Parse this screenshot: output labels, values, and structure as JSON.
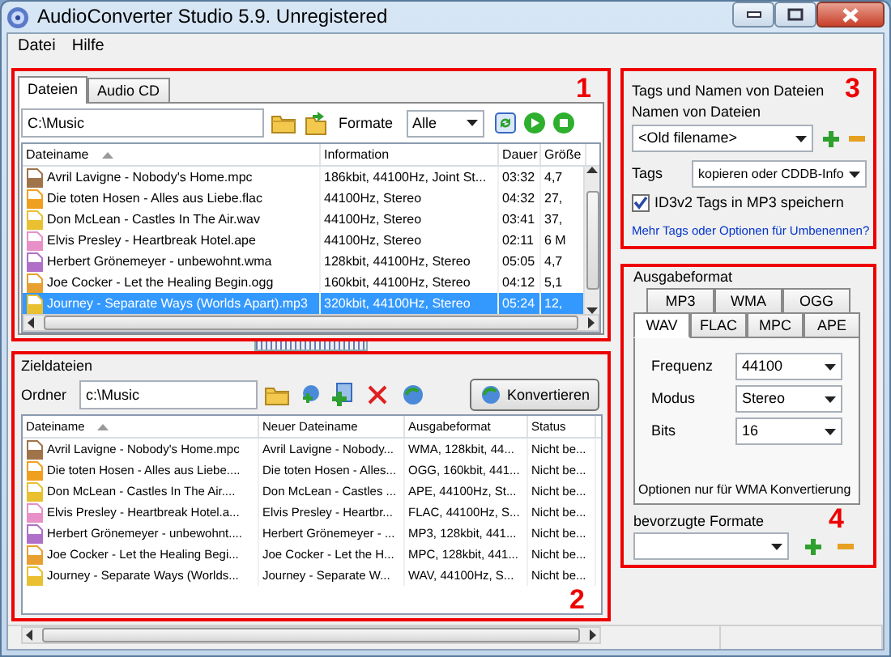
{
  "window": {
    "title": "AudioConverter Studio 5.9. Unregistered"
  },
  "menu": [
    "Datei",
    "Hilfe"
  ],
  "source": {
    "number": "1",
    "tabs": [
      {
        "label": "Dateien",
        "selected": true
      },
      {
        "label": "Audio CD",
        "selected": false
      }
    ],
    "path": "C:\\Music",
    "formats_label": "Formate",
    "formats_value": "Alle",
    "columns": [
      "Dateiname",
      "Information",
      "Dauer",
      "Größe"
    ],
    "rows": [
      {
        "color": "#a0744a",
        "cells": [
          "Avril Lavigne - Nobody's Home.mpc",
          "186kbit, 44100Hz, Joint St...",
          "03:32",
          "4,7"
        ],
        "selected": false
      },
      {
        "color": "#f0a020",
        "cells": [
          "Die toten Hosen - Alles aus Liebe.flac",
          "44100Hz, Stereo",
          "04:32",
          "27,"
        ],
        "selected": false
      },
      {
        "color": "#e8c030",
        "cells": [
          "Don McLean - Castles In The Air.wav",
          "44100Hz, Stereo",
          "03:41",
          "37,"
        ],
        "selected": false
      },
      {
        "color": "#e890c8",
        "cells": [
          "Elvis Presley - Heartbreak Hotel.ape",
          "44100Hz, Stereo",
          "02:11",
          "6 M"
        ],
        "selected": false
      },
      {
        "color": "#b070c8",
        "cells": [
          "Herbert Grönemeyer - unbewohnt.wma",
          "128kbit, 44100Hz, Stereo",
          "05:05",
          "4,7"
        ],
        "selected": false
      },
      {
        "color": "#e8a030",
        "cells": [
          "Joe Cocker - Let the Healing Begin.ogg",
          "160kbit, 44100Hz, Stereo",
          "04:12",
          "5,1"
        ],
        "selected": false
      },
      {
        "color": "#e8c030",
        "cells": [
          "Journey - Separate Ways (Worlds Apart).mp3",
          "320kbit, 44100Hz, Stereo",
          "05:24",
          "12,"
        ],
        "selected": true
      }
    ]
  },
  "target": {
    "number": "2",
    "title": "Zieldateien",
    "folder_label": "Ordner",
    "folder": "c:\\Music",
    "convert_button": "Konvertieren",
    "columns": [
      "Dateiname",
      "Neuer Dateiname",
      "Ausgabeformat",
      "Status"
    ],
    "rows": [
      {
        "color": "#a0744a",
        "cells": [
          "Avril Lavigne - Nobody's Home.mpc",
          "Avril Lavigne - Nobody...",
          "WMA, 128kbit, 44...",
          "Nicht be..."
        ]
      },
      {
        "color": "#f0a020",
        "cells": [
          "Die toten Hosen - Alles aus Liebe....",
          "Die toten Hosen - Alles...",
          "OGG, 160kbit, 441...",
          "Nicht be..."
        ]
      },
      {
        "color": "#e8c030",
        "cells": [
          "Don McLean - Castles In The Air....",
          "Don McLean - Castles ...",
          "APE, 44100Hz, St...",
          "Nicht be..."
        ]
      },
      {
        "color": "#e890c8",
        "cells": [
          "Elvis Presley - Heartbreak Hotel.a...",
          "Elvis Presley - Heartbr...",
          "FLAC, 44100Hz, S...",
          "Nicht be..."
        ]
      },
      {
        "color": "#b070c8",
        "cells": [
          "Herbert Grönemeyer - unbewohnt....",
          "Herbert Grönemeyer - ...",
          "MP3, 128kbit, 441...",
          "Nicht be..."
        ]
      },
      {
        "color": "#e8a030",
        "cells": [
          "Joe Cocker - Let the Healing Begi...",
          "Joe Cocker - Let the H...",
          "MPC, 128kbit, 441...",
          "Nicht be..."
        ]
      },
      {
        "color": "#e8c030",
        "cells": [
          "Journey - Separate Ways (Worlds...",
          "Journey - Separate W...",
          "WAV, 44100Hz, S...",
          "Nicht be..."
        ]
      }
    ]
  },
  "tags": {
    "number": "3",
    "title": "Tags und Namen von Dateien",
    "names_label": "Namen von Dateien",
    "names_value": "<Old filename>",
    "tags_label": "Tags",
    "tags_value": "kopieren oder CDDB-Info",
    "id3": {
      "label": "ID3v2 Tags in MP3 speichern",
      "checked": true
    },
    "link": "Mehr Tags oder Optionen für Umbenennen?"
  },
  "output": {
    "number": "4",
    "title": "Ausgabeformat",
    "tab_rows": [
      [
        {
          "label": "MP3",
          "selected": false
        },
        {
          "label": "WMA",
          "selected": false
        },
        {
          "label": "OGG",
          "selected": false
        }
      ],
      [
        {
          "label": "WAV",
          "selected": true
        },
        {
          "label": "FLAC",
          "selected": false
        },
        {
          "label": "MPC",
          "selected": false
        },
        {
          "label": "APE",
          "selected": false
        }
      ]
    ],
    "fields": [
      {
        "label": "Frequenz",
        "value": "44100"
      },
      {
        "label": "Modus",
        "value": "Stereo"
      },
      {
        "label": "Bits",
        "value": "16"
      }
    ],
    "note": "Optionen nur für WMA Konvertierung",
    "preferred_label": "bevorzugte Formate"
  }
}
